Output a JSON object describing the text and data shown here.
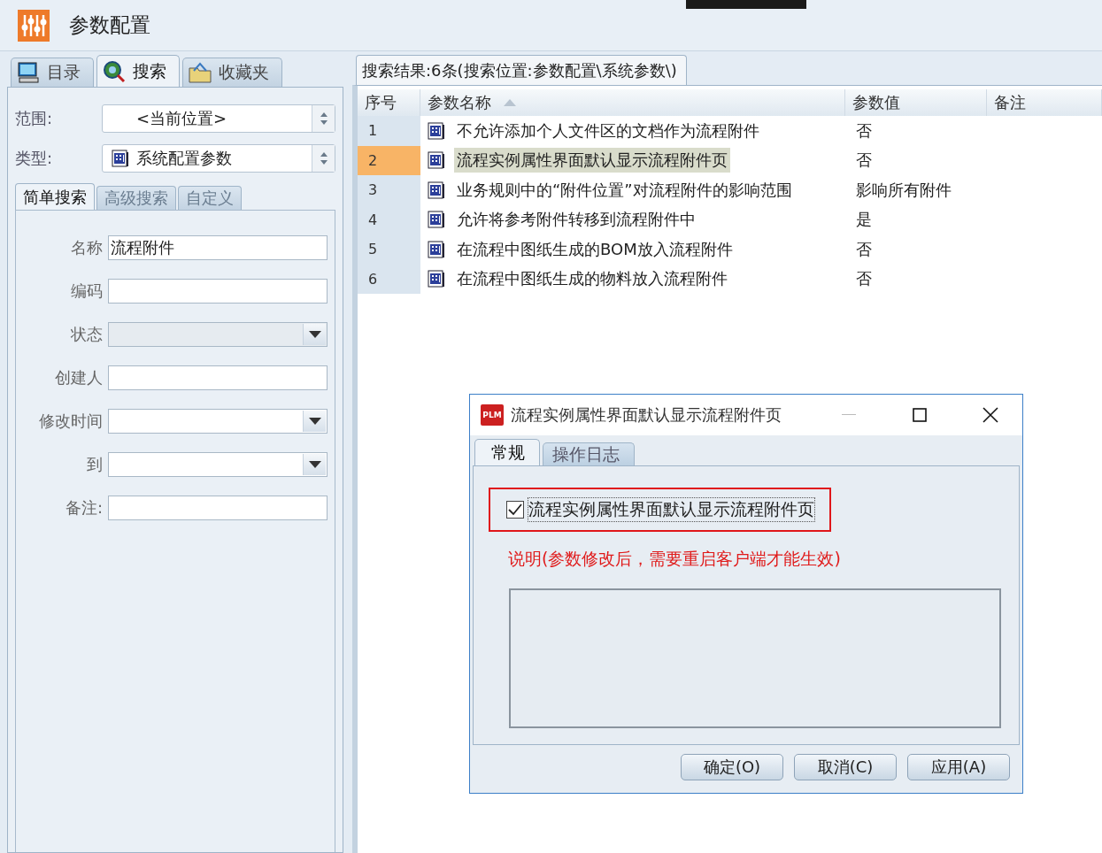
{
  "app": {
    "title": "参数配置"
  },
  "nav_tabs": [
    {
      "label": "目录",
      "selected": false,
      "kind": "catalog"
    },
    {
      "label": "搜索",
      "selected": true,
      "kind": "search"
    },
    {
      "label": "收藏夹",
      "selected": false,
      "kind": "favorites"
    }
  ],
  "scope": {
    "label": "范围:",
    "value": "<当前位置>"
  },
  "type": {
    "label": "类型:",
    "value": "系统配置参数"
  },
  "search_tabs": [
    {
      "label": "简单搜索",
      "selected": true
    },
    {
      "label": "高级搜索",
      "selected": false
    },
    {
      "label": "自定义",
      "selected": false
    }
  ],
  "fields": [
    {
      "label": "名称",
      "value": "流程附件",
      "kind": "text",
      "disabled": false
    },
    {
      "label": "编码",
      "kind": "text",
      "disabled": false
    },
    {
      "label": "状态",
      "kind": "dropdown",
      "disabled": true
    },
    {
      "label": "创建人",
      "kind": "text",
      "disabled": false
    },
    {
      "label": "修改时间",
      "kind": "dropdown",
      "disabled": false
    },
    {
      "label": "到",
      "kind": "dropdown",
      "disabled": false
    },
    {
      "label": "备注:",
      "kind": "text",
      "disabled": false
    }
  ],
  "results": {
    "tab": "搜索结果:6条(搜索位置:参数配置\\系统参数\\)",
    "columns": [
      {
        "label": "序号",
        "sorted": false
      },
      {
        "label": "参数名称",
        "sorted": true
      },
      {
        "label": "参数值",
        "sorted": false
      },
      {
        "label": "备注",
        "sorted": false
      }
    ],
    "rows": [
      {
        "index": "1",
        "name": "不允许添加个人文件区的文档作为流程附件",
        "value": "否",
        "selected": false
      },
      {
        "index": "2",
        "name": "流程实例属性界面默认显示流程附件页",
        "value": "否",
        "selected": true
      },
      {
        "index": "3",
        "name": "业务规则中的“附件位置”对流程附件的影响范围",
        "value": "影响所有附件",
        "selected": false
      },
      {
        "index": "4",
        "name": "允许将参考附件转移到流程附件中",
        "value": "是",
        "selected": false
      },
      {
        "index": "5",
        "name": "在流程中图纸生成的BOM放入流程附件",
        "value": "否",
        "selected": false
      },
      {
        "index": "6",
        "name": "在流程中图纸生成的物料放入流程附件",
        "value": "否",
        "selected": false
      }
    ]
  },
  "dialog": {
    "badge": "PLM",
    "title": "流程实例属性界面默认显示流程附件页",
    "tabs": [
      {
        "label": "常规",
        "selected": true
      },
      {
        "label": "操作日志",
        "selected": false
      }
    ],
    "checkbox": {
      "label": "流程实例属性界面默认显示流程附件页",
      "checked": true
    },
    "note": "说明(参数修改后，需要重启客户端才能生效)",
    "buttons": [
      "确定(O)",
      "取消(C)",
      "应用(A)"
    ]
  }
}
